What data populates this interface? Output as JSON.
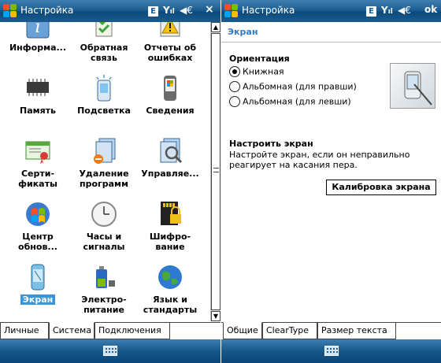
{
  "left_screen": {
    "title": "Настройка",
    "status": {
      "network_badge": "E",
      "signal_icon": "signal-bars-icon",
      "speaker_icon": "speaker-icon",
      "close_label": "×"
    },
    "items": [
      {
        "label": "Информа...",
        "icon": "info-icon"
      },
      {
        "label": "Обратная\nсвязь",
        "icon": "feedback-icon"
      },
      {
        "label": "Отчеты об\nошибках",
        "icon": "error-report-icon"
      },
      {
        "label": "Память",
        "icon": "memory-chip-icon"
      },
      {
        "label": "Подсветка",
        "icon": "backlight-icon"
      },
      {
        "label": "Сведения",
        "icon": "device-info-icon"
      },
      {
        "label": "Серти-\nфикаты",
        "icon": "certificate-icon"
      },
      {
        "label": "Удаление\nпрограмм",
        "icon": "remove-programs-icon"
      },
      {
        "label": "Управляе...",
        "icon": "managed-programs-icon"
      },
      {
        "label": "Центр\nобнов...",
        "icon": "update-center-icon"
      },
      {
        "label": "Часы и\nсигналы",
        "icon": "clock-icon"
      },
      {
        "label": "Шифро-\nвание",
        "icon": "encryption-icon"
      },
      {
        "label": "Экран",
        "icon": "screen-icon",
        "selected": true
      },
      {
        "label": "Электро-\nпитание",
        "icon": "power-icon"
      },
      {
        "label": "Язык и\nстандарты",
        "icon": "regional-globe-icon"
      }
    ],
    "tabs": [
      "Личные",
      "Система",
      "Подключения"
    ],
    "active_tab": "Система"
  },
  "right_screen": {
    "title": "Настройка",
    "status": {
      "network_badge": "E",
      "signal_icon": "signal-bars-icon",
      "speaker_icon": "speaker-icon",
      "ok_label": "ok"
    },
    "page_heading": "Экран",
    "orientation": {
      "title": "Ориентация",
      "options": [
        "Книжная",
        "Альбомная (для правши)",
        "Альбомная (для левши)"
      ],
      "selected": "Книжная"
    },
    "calibrate": {
      "title": "Настроить экран",
      "description": "Настройте экран, если он неправильно реагирует на касания пера.",
      "button_label": "Калибровка экрана"
    },
    "tabs": [
      "Общие",
      "ClearType",
      "Размер текста"
    ],
    "active_tab": "Общие"
  },
  "colors": {
    "titlebar": "#1d5f93",
    "accent": "#2d7bc4",
    "selection": "#3a95d8"
  }
}
